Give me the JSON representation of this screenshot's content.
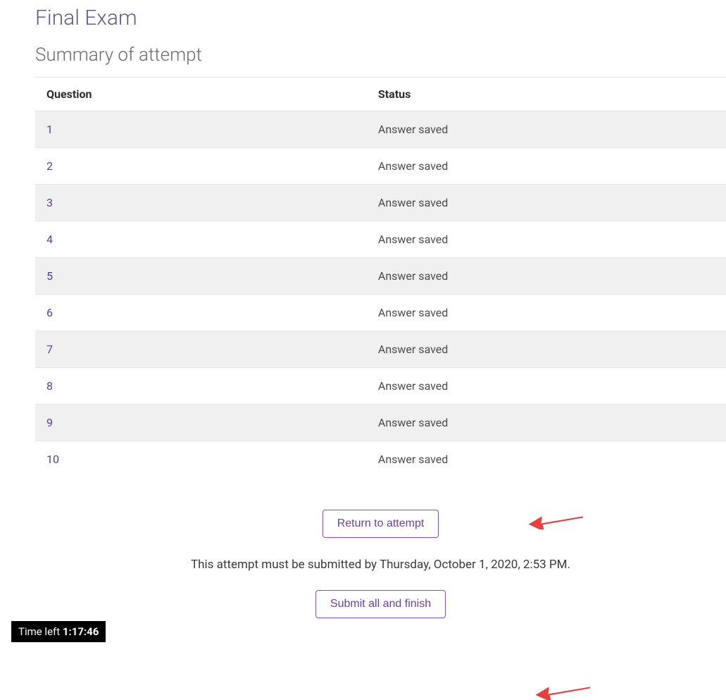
{
  "page": {
    "title": "Final Exam",
    "subtitle": "Summary of attempt"
  },
  "table": {
    "headers": {
      "question": "Question",
      "status": "Status"
    },
    "rows": [
      {
        "question": "1",
        "status": "Answer saved"
      },
      {
        "question": "2",
        "status": "Answer saved"
      },
      {
        "question": "3",
        "status": "Answer saved"
      },
      {
        "question": "4",
        "status": "Answer saved"
      },
      {
        "question": "5",
        "status": "Answer saved"
      },
      {
        "question": "6",
        "status": "Answer saved"
      },
      {
        "question": "7",
        "status": "Answer saved"
      },
      {
        "question": "8",
        "status": "Answer saved"
      },
      {
        "question": "9",
        "status": "Answer saved"
      },
      {
        "question": "10",
        "status": "Answer saved"
      }
    ]
  },
  "actions": {
    "return_label": "Return to attempt",
    "deadline_text": "This attempt must be submitted by Thursday, October 1, 2020, 2:53 PM.",
    "submit_label": "Submit all and finish"
  },
  "timer": {
    "label": "Time left ",
    "value": "1:17:46"
  },
  "annotations": {
    "arrow_color": "#e5403f"
  }
}
